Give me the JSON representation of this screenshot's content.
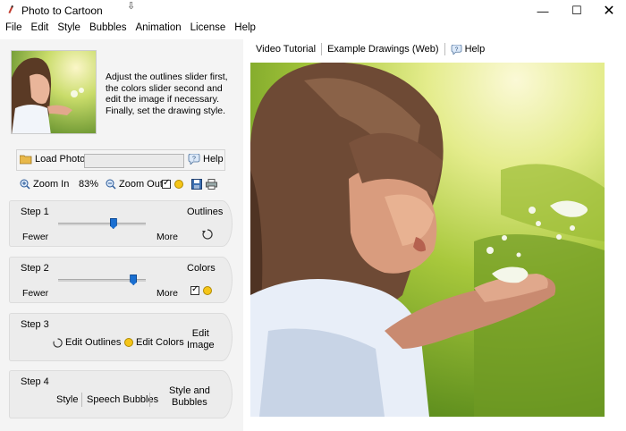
{
  "window": {
    "title": "Photo to Cartoon",
    "minimize_glyph": "—",
    "maximize_glyph": "☐",
    "close_glyph": "✕"
  },
  "menu": [
    "File",
    "Edit",
    "Style",
    "Bubbles",
    "Animation",
    "License",
    "Help"
  ],
  "intro": {
    "text": "Adjust the outlines slider first, the colors slider second and edit the image if necessary. Finally, set the drawing style."
  },
  "load": {
    "load_label": "Load Photo",
    "file_value": "",
    "help_label": "Help"
  },
  "zoom": {
    "zoom_in_label": "Zoom In",
    "level": "83%",
    "zoom_out_label": "Zoom Out",
    "checkbox_checked": true
  },
  "steps": {
    "step1": {
      "title": "Step 1",
      "right_label": "Outlines",
      "min_label": "Fewer",
      "max_label": "More",
      "value": 0.63
    },
    "step2": {
      "title": "Step 2",
      "right_label": "Colors",
      "min_label": "Fewer",
      "max_label": "More",
      "value": 0.86,
      "checkbox_checked": true
    },
    "step3": {
      "title": "Step 3",
      "edit_outlines_label": "Edit Outlines",
      "edit_colors_label": "Edit Colors",
      "edit_image_label_1": "Edit",
      "edit_image_label_2": "Image"
    },
    "step4": {
      "title": "Step 4",
      "style_label": "Style",
      "speech_bubbles_label": "Speech Bubbles",
      "style_and_bubbles_label_1": "Style and",
      "style_and_bubbles_label_2": "Bubbles"
    }
  },
  "top_tabs": {
    "video_tutorial": "Video Tutorial",
    "example_drawings": "Example Drawings (Web)",
    "help": "Help"
  },
  "colors": {
    "accent": "#1a6fd1",
    "panel_bg": "#f4f4f4",
    "step_bg": "#ececec"
  }
}
